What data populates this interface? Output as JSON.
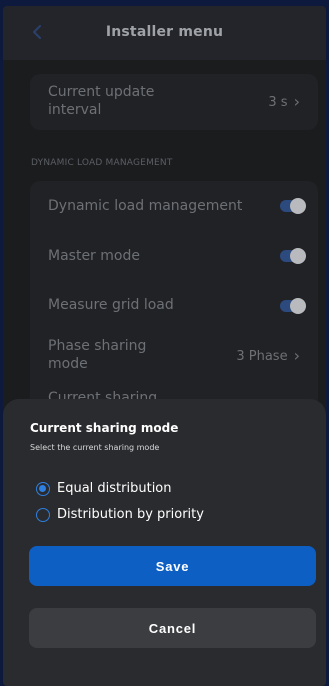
{
  "header": {
    "title": "Installer menu",
    "back_icon": "chevron-left-icon"
  },
  "update": {
    "label": "Current update interval",
    "value": "3 s"
  },
  "section": {
    "label": "DYNAMIC LOAD MANAGEMENT"
  },
  "dlm": {
    "items": [
      {
        "label": "Dynamic load management",
        "toggle_on": true
      },
      {
        "label": "Master mode",
        "toggle_on": true
      },
      {
        "label": "Measure grid load",
        "toggle_on": true
      }
    ],
    "phase_sharing": {
      "label": "Phase sharing mode",
      "value": "3 Phase"
    },
    "current_sharing": {
      "label": "Current sharing"
    }
  },
  "sheet": {
    "title": "Current sharing mode",
    "subtitle": "Select the current sharing mode",
    "options": [
      {
        "label": "Equal distribution",
        "selected": true
      },
      {
        "label": "Distribution by priority",
        "selected": false
      }
    ],
    "save_label": "Save",
    "cancel_label": "Cancel"
  },
  "colors": {
    "accent": "#0e5fc4",
    "radio": "#2f7fe0",
    "background": "#1b1c1e",
    "sheet": "#2a2b2e"
  }
}
